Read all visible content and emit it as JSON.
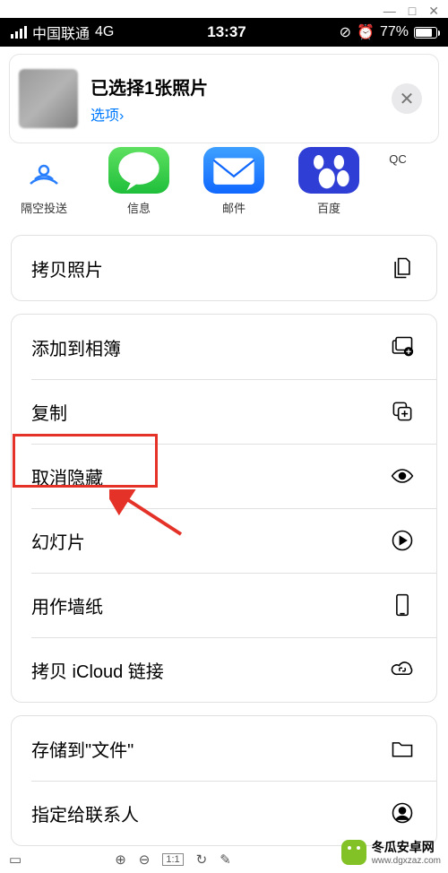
{
  "statusbar": {
    "carrier": "中国联通",
    "network": "4G",
    "time": "13:37",
    "battery": "77%"
  },
  "sheet": {
    "title": "已选择1张照片",
    "options": "选项",
    "chevron": "›"
  },
  "share": {
    "airdrop": "隔空投送",
    "messages": "信息",
    "mail": "邮件",
    "baidu": "百度",
    "qq": "QC"
  },
  "actions": {
    "copy_photo": "拷贝照片",
    "add_to_album": "添加到相簿",
    "duplicate": "复制",
    "unhide": "取消隐藏",
    "slideshow": "幻灯片",
    "use_as_wallpaper": "用作墙纸",
    "copy_icloud_link": "拷贝 iCloud 链接",
    "save_to_files": "存储到\"文件\"",
    "assign_to_contact": "指定给联系人"
  },
  "watermark": {
    "name": "冬瓜安卓网",
    "url": "www.dgxzaz.com"
  },
  "toolbar_page": "1:1"
}
